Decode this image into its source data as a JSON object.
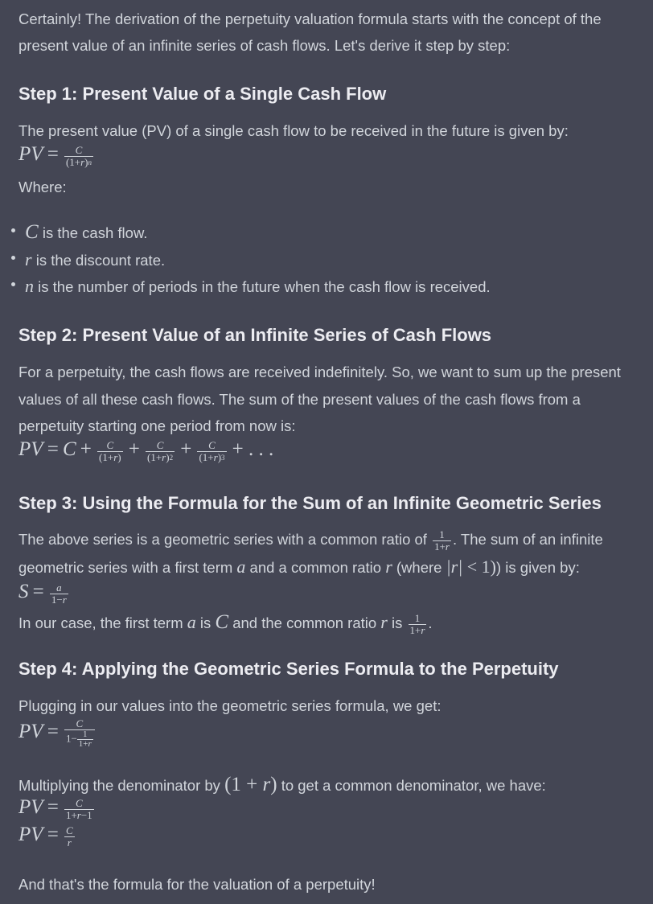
{
  "intro": {
    "line1": "Certainly! The derivation of the perpetuity valuation formula starts with the concept of the",
    "line2": "present value of an infinite series of cash flows. Let's derive it step by step:"
  },
  "step1": {
    "title": "Step 1: Present Value of a Single Cash Flow",
    "text": "The present value (PV) of a single cash flow to be received in the future is given by:",
    "where": "Where:",
    "bullets": [
      {
        "sym": "C",
        "text": " is the cash flow."
      },
      {
        "sym": "r",
        "text": " is the discount rate."
      },
      {
        "sym": "n",
        "text": " is the number of periods in the future when the cash flow is received."
      }
    ]
  },
  "step2": {
    "title": "Step 2: Present Value of an Infinite Series of Cash Flows",
    "line1": "For a perpetuity, the cash flows are received indefinitely. So, we want to sum up the present",
    "line2": "values of all these cash flows. The sum of the present values of the cash flows from a",
    "line3": "perpetuity starting one period from now is:"
  },
  "step3": {
    "title": "Step 3: Using the Formula for the Sum of an Infinite Geometric Series",
    "line1_a": "The above series is a geometric series with a common ratio of ",
    "line1_b": ". The sum of an infinite",
    "line2_a": "geometric series with a first term ",
    "line2_b": " and a common ratio ",
    "line2_c": " (where ",
    "line2_d": ") is given by:",
    "case_a": "In our case, the first term ",
    "case_b": " is ",
    "case_c": " and the common ratio ",
    "case_d": " is "
  },
  "step4": {
    "title": "Step 4: Applying the Geometric Series Formula to the Perpetuity",
    "text": "Plugging in our values into the geometric series formula, we get:",
    "mult_a": "Multiplying the denominator by ",
    "mult_b": " to get a common denominator, we have:"
  },
  "conclusion": "And that's the formula for the valuation of a perpetuity!"
}
